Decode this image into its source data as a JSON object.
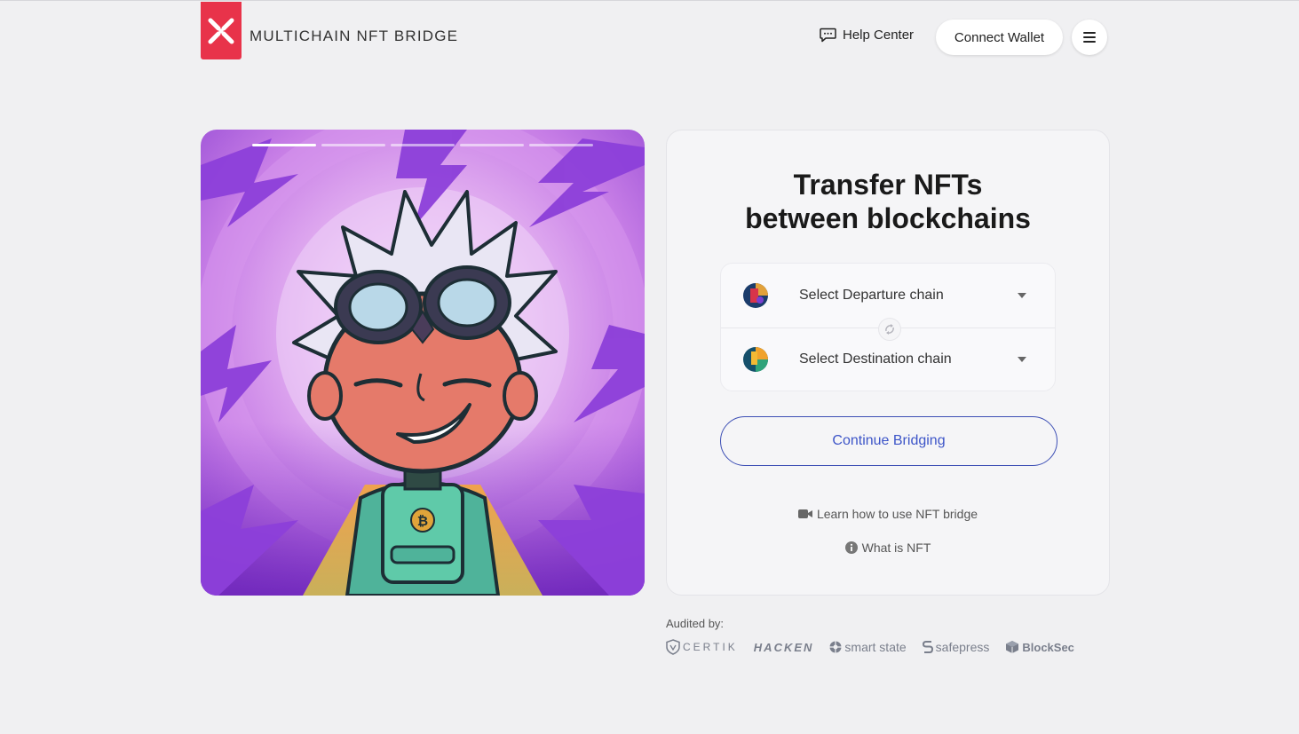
{
  "header": {
    "brand": "MULTICHAIN NFT BRIDGE",
    "help_label": "Help Center",
    "connect_label": "Connect Wallet"
  },
  "colors": {
    "brand_red": "#e8334a",
    "accent_blue": "#3d55c8",
    "page_bg": "#f0f0f2"
  },
  "slider": {
    "segment_count": 5,
    "active_segment": 1,
    "active_progress": 0.1
  },
  "transfer": {
    "title_line1": "Transfer NFTs",
    "title_line2": "between blockchains",
    "departure_label": "Select Departure chain",
    "destination_label": "Select Destination chain",
    "continue_label": "Continue Bridging",
    "learn_label": "Learn how to use NFT bridge",
    "what_label": "What is NFT"
  },
  "audit": {
    "label": "Audited by:",
    "auditors": [
      "CERTIK",
      "HACKEN",
      "smart state",
      "safepress",
      "BlockSec"
    ]
  },
  "icons": {
    "help": "chat-bubble-icon",
    "menu": "hamburger-icon",
    "swap": "swap-icon",
    "video": "video-camera-icon",
    "info": "info-icon"
  }
}
